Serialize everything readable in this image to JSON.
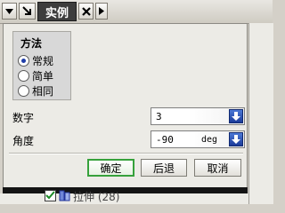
{
  "titlebar": {
    "title": "实例"
  },
  "method_group": {
    "title": "方法",
    "options": [
      "常规",
      "简单",
      "相同"
    ],
    "selected_index": 0
  },
  "fields": {
    "number": {
      "label": "数字",
      "value": "3"
    },
    "angle": {
      "label": "角度",
      "value": "-90",
      "unit": "deg"
    }
  },
  "buttons": {
    "ok": "确定",
    "back": "后退",
    "cancel": "取消"
  },
  "tree": {
    "item_text": "拉伸 (28)"
  },
  "colors": {
    "ok_border": "#36a13b",
    "spin_blue": "#1b3b9a",
    "title_tab": "#3d3d3d"
  }
}
